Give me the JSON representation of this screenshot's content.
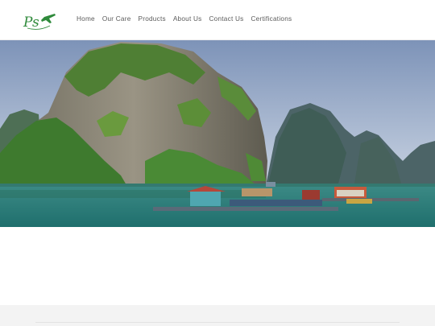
{
  "brand": {
    "logo_text": "Ps"
  },
  "nav": {
    "items": [
      "Home",
      "Our Care",
      "Products",
      "About Us",
      "Contact Us",
      "Certifications"
    ]
  },
  "hero": {
    "image": "bay-with-limestone-karsts-and-floating-village"
  },
  "colors": {
    "brand": "#2f8a3b",
    "nav_text": "#5a5a5a",
    "footer_bg": "#f3f3f3"
  }
}
